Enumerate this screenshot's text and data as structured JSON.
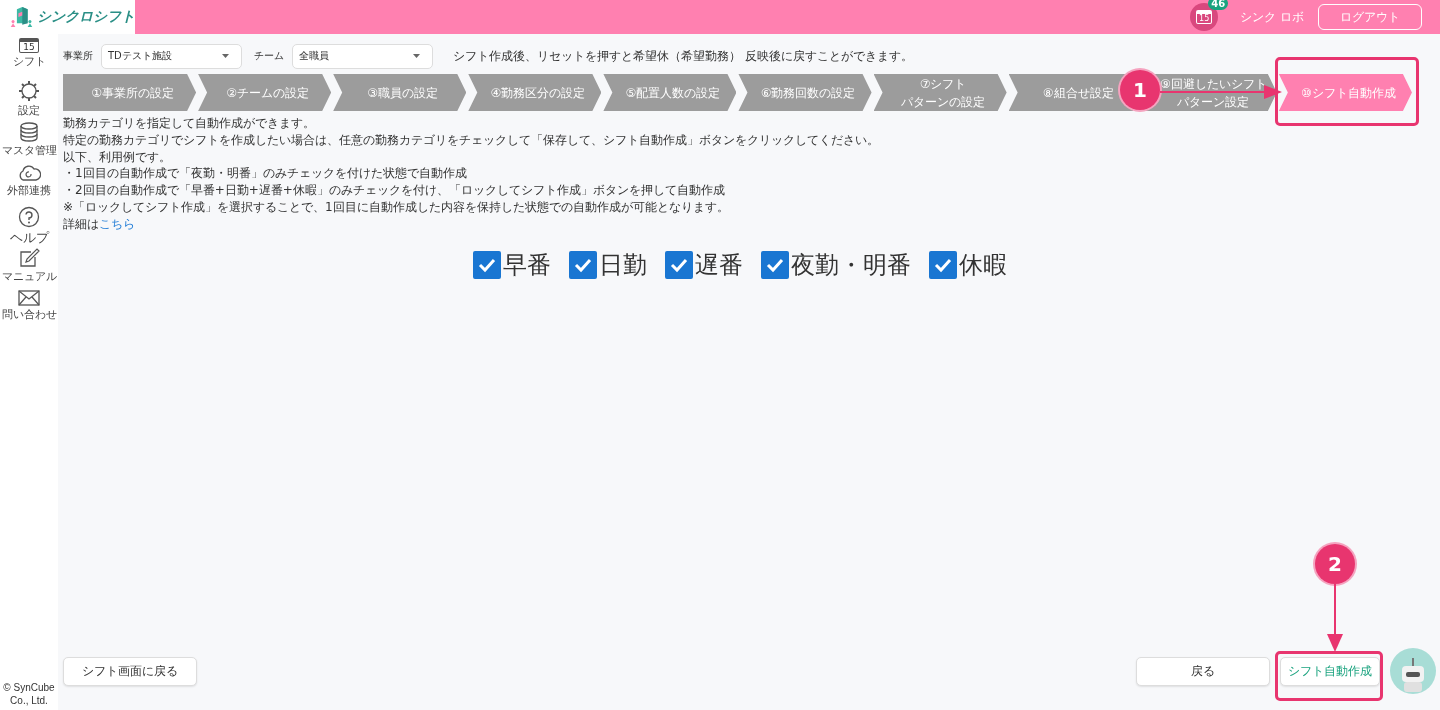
{
  "header": {
    "logo_text": "シンクロシフト",
    "calendar_day": "15",
    "badge": "46",
    "user": "シンク ロボ",
    "logout": "ログアウト"
  },
  "sidebar": {
    "items": [
      {
        "kind": "calendar",
        "icon_text": "15",
        "label": "シフト"
      },
      {
        "kind": "gear",
        "label": "設定"
      },
      {
        "kind": "database",
        "label": "マスタ管理"
      },
      {
        "kind": "cloud",
        "label": "外部連携"
      },
      {
        "kind": "help",
        "label": "ヘルプ"
      },
      {
        "kind": "edit",
        "label": "マニュアル"
      },
      {
        "kind": "mail",
        "label": "問い合わせ"
      }
    ],
    "copyright": "© SynCube Co., Ltd."
  },
  "filters": [
    {
      "label": "事業所",
      "value": "TDテスト施設"
    },
    {
      "label": "チーム",
      "value": "全職員"
    }
  ],
  "notice": "シフト作成後、リセットを押すと希望休（希望勤務） 反映後に戻すことができます。",
  "steps": [
    {
      "label": "①事業所の設定",
      "selected": false
    },
    {
      "label": "②チームの設定",
      "selected": false
    },
    {
      "label": "③職員の設定",
      "selected": false
    },
    {
      "label": "④勤務区分の設定",
      "selected": false
    },
    {
      "label": "⑤配置人数の設定",
      "selected": false
    },
    {
      "label": "⑥勤務回数の設定",
      "selected": false
    },
    {
      "label": "⑦シフト",
      "label_2": "パターンの設定",
      "selected": false
    },
    {
      "label": "⑧組合せ設定",
      "selected": false
    },
    {
      "label": "⑨回避したいシフト",
      "label_2": "パターン設定",
      "selected": false
    },
    {
      "label": "⑩シフト自動作成",
      "selected": true
    }
  ],
  "description": [
    "勤務カテゴリを指定して自動作成ができます。",
    "特定の勤務カテゴリでシフトを作成したい場合は、任意の勤務カテゴリをチェックして「保存して、シフト自動作成」ボタンをクリックしてください。",
    "以下、利用例です。",
    "・1回目の自動作成で「夜勤・明番」のみチェックを付けた状態で自動作成",
    "・2回目の自動作成で「早番+日勤+遅番+休暇」のみチェックを付け、「ロックしてシフト作成」ボタンを押して自動作成",
    "※「ロックしてシフト作成」を選択することで、1回目に自動作成した内容を保持した状態での自動作成が可能となります。"
  ],
  "details": {
    "text": "詳細は",
    "link": "こちら"
  },
  "categories": [
    {
      "label": "早番",
      "checked": true
    },
    {
      "label": "日勤",
      "checked": true
    },
    {
      "label": "遅番",
      "checked": true
    },
    {
      "label": "夜勤・明番",
      "checked": true
    },
    {
      "label": "休暇",
      "checked": true
    }
  ],
  "buttons": {
    "back_to_shift": "シフト画面に戻る",
    "back": "戻る",
    "auto_create": "シフト自動作成"
  },
  "annotations": [
    {
      "label": "1"
    },
    {
      "label": "2"
    }
  ]
}
